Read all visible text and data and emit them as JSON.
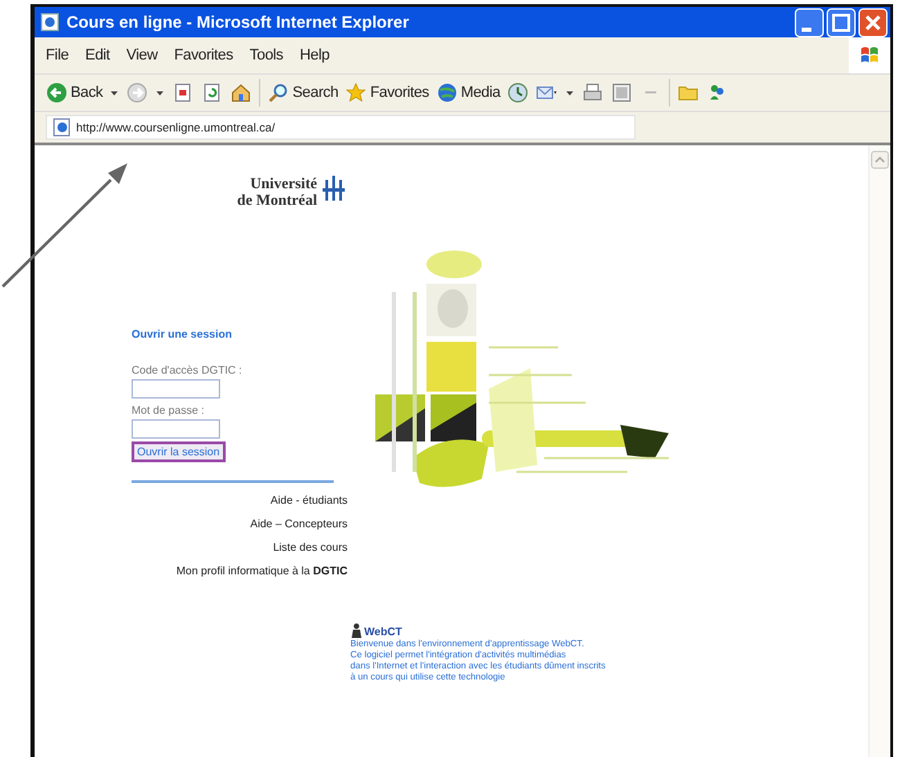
{
  "window": {
    "title": "Cours en ligne - Microsoft Internet Explorer"
  },
  "menu": [
    "File",
    "Edit",
    "View",
    "Favorites",
    "Tools",
    "Help"
  ],
  "toolbar": [
    {
      "kind": "back",
      "label": "Back"
    },
    {
      "kind": "forward"
    },
    {
      "kind": "stop"
    },
    {
      "kind": "refresh"
    },
    {
      "kind": "home"
    },
    {
      "kind": "search",
      "label": "Search"
    },
    {
      "kind": "favorites",
      "label": "Favorites"
    },
    {
      "kind": "media",
      "label": "Media"
    },
    {
      "kind": "history"
    },
    {
      "kind": "mail"
    },
    {
      "kind": "print"
    },
    {
      "kind": "edit"
    },
    {
      "kind": "discuss"
    },
    {
      "kind": "folder"
    },
    {
      "kind": "messenger"
    }
  ],
  "address": {
    "value": "http://www.coursenligne.umontreal.ca/"
  },
  "page": {
    "logo": {
      "line_1": "Université",
      "line_2": "de Montréal"
    },
    "login": {
      "heading": "Ouvrir une session",
      "fields": [
        {
          "label": "Code d'accès DGTIC :"
        },
        {
          "label": "Mot de passe :"
        }
      ],
      "button": "Ouvrir la session"
    },
    "links": [
      "Aide - étudiants",
      "Aide – Concepteurs",
      "Liste des cours",
      "Mon profil informatique à la **DGTIC**"
    ],
    "webct": {
      "title": "WebCT",
      "lines": [
        "Bienvenue dans l'environnement d'apprentissage WebCT.",
        "Ce logiciel permet l'intégration d'activités multimédias",
        "dans l'Internet et l'interaction avec les étudiants dûment inscrits",
        "à un cours qui utilise cette technologie"
      ]
    }
  }
}
